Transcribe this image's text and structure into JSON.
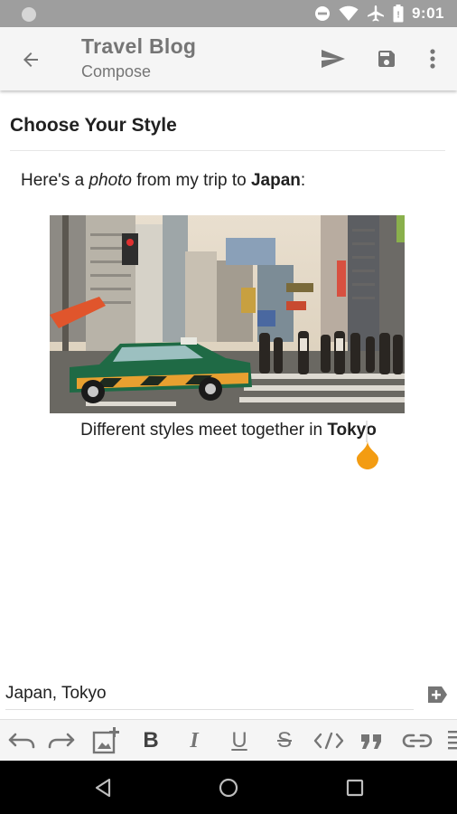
{
  "status_bar": {
    "time": "9:01",
    "icons": [
      "notification-dot-icon",
      "do-not-disturb-icon",
      "wifi-icon",
      "airplane-mode-icon",
      "battery-icon"
    ]
  },
  "app_bar": {
    "title": "Travel Blog",
    "subtitle": "Compose",
    "actions": [
      "back-arrow-icon",
      "send-icon",
      "save-icon",
      "more-vert-icon"
    ]
  },
  "editor": {
    "post_title": "Choose Your Style",
    "paragraph": {
      "prefix": "Here's a ",
      "italic": "photo",
      "middle": " from my trip to ",
      "bold": "Japan",
      "suffix": ":"
    },
    "image": {
      "description": "Tokyo street crossing photo"
    },
    "caption": {
      "text": "Different styles meet together in ",
      "bold": "Tokyo"
    }
  },
  "tags": {
    "value": "Japan, Tokyo",
    "add_icon": "add-tag-icon"
  },
  "format_toolbar": {
    "buttons": [
      "undo-icon",
      "redo-icon",
      "add-media-icon",
      "bold",
      "italic",
      "underline",
      "strikethrough",
      "html-icon",
      "quote-icon",
      "link-icon",
      "list-icon"
    ],
    "bold_label": "B",
    "italic_label": "I",
    "underline_label": "U",
    "strike_label": "S"
  },
  "colors": {
    "accent": "#f39c12",
    "status_bar": "#9e9e9e",
    "app_bar": "#f5f5f5",
    "icon_gray": "#757575"
  },
  "nav_bar": {
    "buttons": [
      "back-triangle-icon",
      "home-circle-icon",
      "recents-square-icon"
    ]
  }
}
